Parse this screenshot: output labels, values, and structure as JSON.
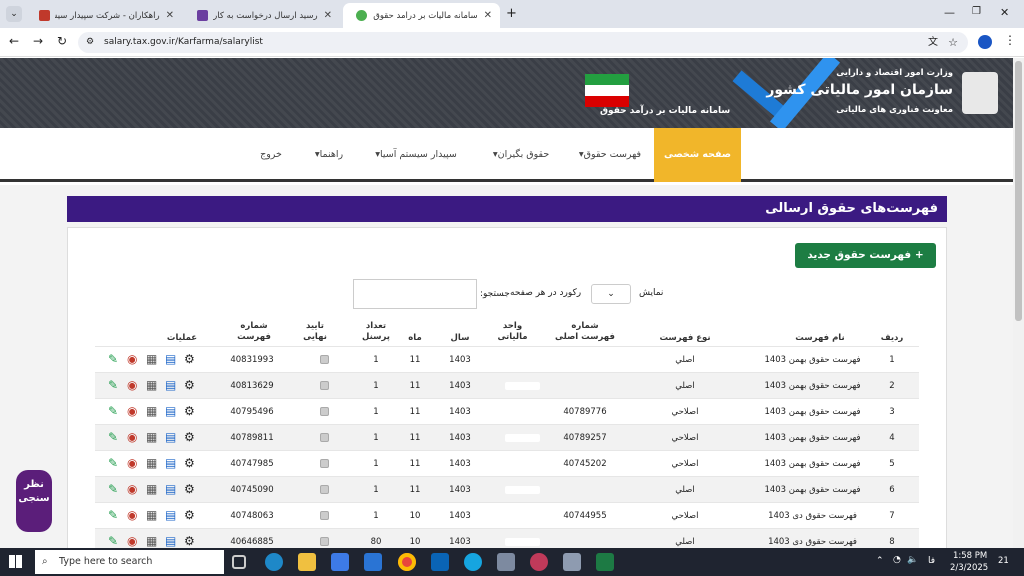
{
  "browser": {
    "tabs": [
      {
        "title": "راهکاران - شرکت سپیدار سیستم آ...",
        "color": "#c0392b"
      },
      {
        "title": "رسید ارسال درخواست به کارپوشه...",
        "color": "#6b3fa0"
      },
      {
        "title": "سامانه مالیات بر درآمد حقوق",
        "color": "#4caf50"
      }
    ],
    "url": "salary.tax.gov.ir/Karfarma/salarylist"
  },
  "banner": {
    "ministry": "وزارت امور اقتصاد و دارایی",
    "org": "سازمان امور مالیاتی کشور",
    "deputy": "معاونت فناوری های مالیاتی",
    "system": "سامانه مالیات بر درآمد حقوق"
  },
  "nav": {
    "home": "صفحه شخصی",
    "salary_list": "فهرست حقوق",
    "payee_salary": "حقوق بگیران",
    "company": "سپیدار سیستم آسیا",
    "help": "راهنما",
    "logout": "خروج"
  },
  "page": {
    "title": "فهرست‌های حقوق ارسالی",
    "new_button": "+ فهرست حقوق جدید",
    "show_label": "نمایش",
    "per_page_label": "رکورد در هر صفحه",
    "search_label": "جستجو:"
  },
  "table": {
    "headers": {
      "row": "ردیف",
      "name": "نام فهرست",
      "type": "نوع فهرست",
      "original": "شماره فهرست اصلی",
      "unit": "واحد مالیاتی",
      "year": "سال",
      "month": "ماه",
      "staff": "تعداد پرسنل",
      "final": "تایید نهایی",
      "number": "شماره فهرست",
      "ops": "عملیات"
    },
    "rows": [
      {
        "row": "1",
        "name": "فهرست حقوق بهمن 1403",
        "type": "اصلي",
        "original": "",
        "year": "1403",
        "month": "11",
        "staff": "1",
        "number": "40831993"
      },
      {
        "row": "2",
        "name": "فهرست حقوق بهمن 1403",
        "type": "اصلي",
        "original": "",
        "year": "1403",
        "month": "11",
        "staff": "1",
        "number": "40813629"
      },
      {
        "row": "3",
        "name": "فهرست حقوق بهمن 1403",
        "type": "اصلاحي",
        "original": "40789776",
        "year": "1403",
        "month": "11",
        "staff": "1",
        "number": "40795496"
      },
      {
        "row": "4",
        "name": "فهرست حقوق بهمن 1403",
        "type": "اصلاحي",
        "original": "40789257",
        "year": "1403",
        "month": "11",
        "staff": "1",
        "number": "40789811"
      },
      {
        "row": "5",
        "name": "فهرست حقوق بهمن 1403",
        "type": "اصلاحي",
        "original": "40745202",
        "year": "1403",
        "month": "11",
        "staff": "1",
        "number": "40747985"
      },
      {
        "row": "6",
        "name": "فهرست حقوق بهمن 1403",
        "type": "اصلي",
        "original": "",
        "year": "1403",
        "month": "11",
        "staff": "1",
        "number": "40745090"
      },
      {
        "row": "7",
        "name": "فهرست حقوق دی 1403",
        "type": "اصلاحي",
        "original": "40744955",
        "year": "1403",
        "month": "10",
        "staff": "1",
        "number": "40748063"
      },
      {
        "row": "8",
        "name": "فهرست حقوق دی 1403",
        "type": "اصلي",
        "original": "",
        "year": "1403",
        "month": "10",
        "staff": "80",
        "number": "40646885"
      }
    ]
  },
  "feedback": "نظر سنجی",
  "taskbar": {
    "search": "Type here to search",
    "time": "1:58 PM",
    "date": "2/3/2025",
    "lang": "فا",
    "notif": "21"
  },
  "colors": {
    "purple": "#3b1a82",
    "green": "#1d7d43",
    "yellow": "#f1b62a"
  }
}
